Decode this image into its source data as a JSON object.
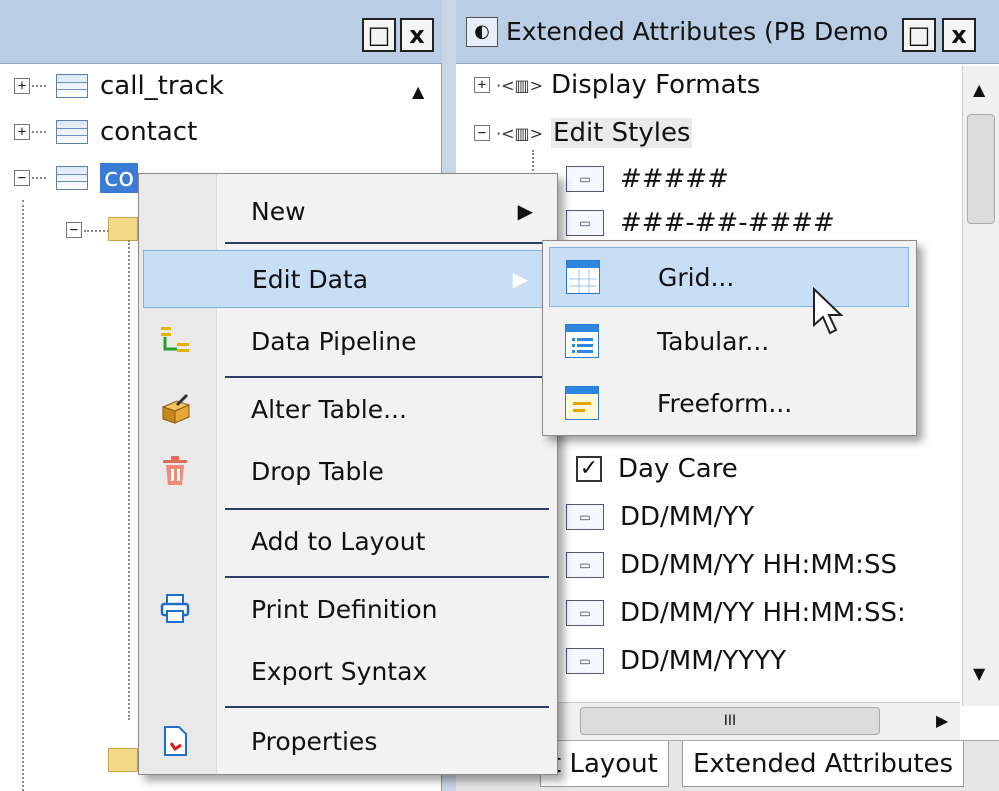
{
  "left_panel": {
    "win_buttons": {
      "restore": "□",
      "close": "x"
    },
    "tree": [
      {
        "expander": "+",
        "label": "call_track"
      },
      {
        "expander": "+",
        "label": "contact"
      },
      {
        "expander": "−",
        "label": "co"
      }
    ]
  },
  "right_panel": {
    "title": "Extended Attributes (PB Demo",
    "win_buttons": {
      "restore": "□",
      "close": "x"
    },
    "items": [
      {
        "expander": "+",
        "label": "Display Formats",
        "kind": "folder"
      },
      {
        "expander": "−",
        "label": "Edit Styles",
        "kind": "folder"
      },
      {
        "label": "#####",
        "kind": "format"
      },
      {
        "label": "###-##-####",
        "kind": "format"
      },
      {
        "label": "Day Care",
        "kind": "checkbox"
      },
      {
        "label": "DD/MM/YY",
        "kind": "format"
      },
      {
        "label": "DD/MM/YY HH:MM:SS",
        "kind": "format"
      },
      {
        "label": "DD/MM/YY HH:MM:SS:",
        "kind": "format"
      },
      {
        "label": "DD/MM/YYYY",
        "kind": "format"
      }
    ],
    "hscroll_thumb": "III",
    "tabs": [
      "t Layout",
      "Extended Attributes"
    ]
  },
  "context_menu": {
    "items": [
      {
        "label": "New",
        "has_submenu": true,
        "icon": ""
      },
      {
        "label": "Edit Data",
        "has_submenu": true,
        "icon": "",
        "highlighted": true
      },
      {
        "label": "Data Pipeline",
        "icon": "data-pipeline-icon"
      },
      {
        "label": "Alter Table...",
        "icon": "alter-table-icon"
      },
      {
        "label": "Drop Table",
        "icon": "trash-icon"
      },
      {
        "label": "Add to Layout",
        "icon": ""
      },
      {
        "label": "Print Definition",
        "icon": "printer-icon"
      },
      {
        "label": "Export Syntax",
        "icon": ""
      },
      {
        "label": "Properties",
        "icon": "properties-icon"
      }
    ]
  },
  "submenu": {
    "items": [
      {
        "label": "Grid...",
        "icon": "grid-icon",
        "highlighted": true
      },
      {
        "label": "Tabular...",
        "icon": "tabular-icon"
      },
      {
        "label": "Freeform...",
        "icon": "freeform-icon"
      }
    ]
  },
  "colors": {
    "titlebar": "#b9cde5",
    "highlight": "#c7def6",
    "menu_bg": "#f2f2f2"
  }
}
